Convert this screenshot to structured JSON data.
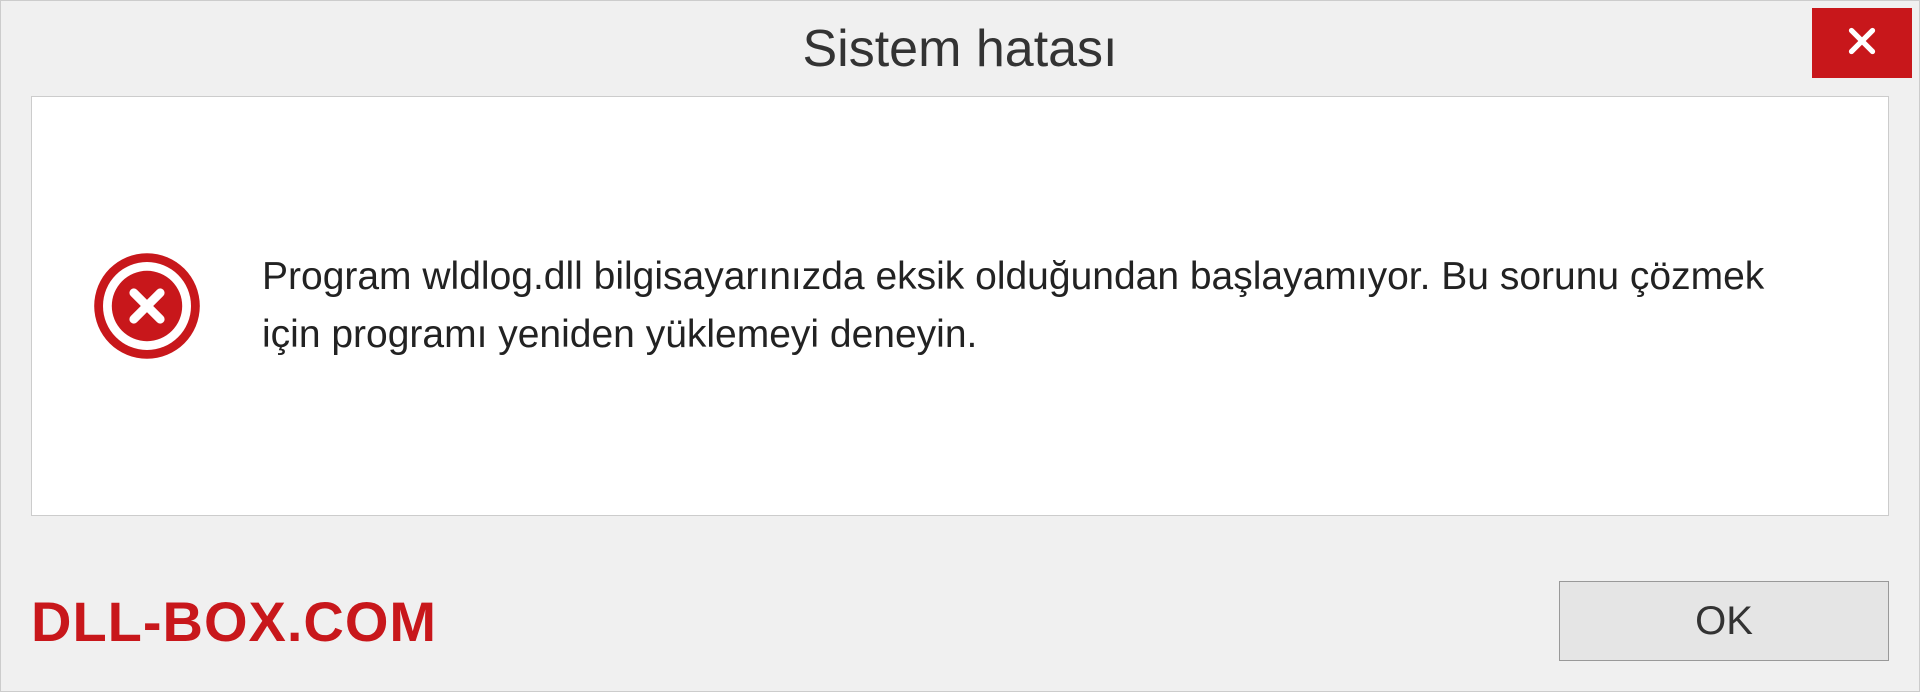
{
  "dialog": {
    "title": "Sistem hatası",
    "message": "Program wldlog.dll bilgisayarınızda eksik olduğundan başlayamıyor. Bu sorunu çözmek için programı yeniden yüklemeyi deneyin.",
    "ok_label": "OK"
  },
  "watermark": "DLL-BOX.COM",
  "colors": {
    "accent_red": "#c8171b",
    "background": "#f0f0f0",
    "panel": "#ffffff"
  }
}
